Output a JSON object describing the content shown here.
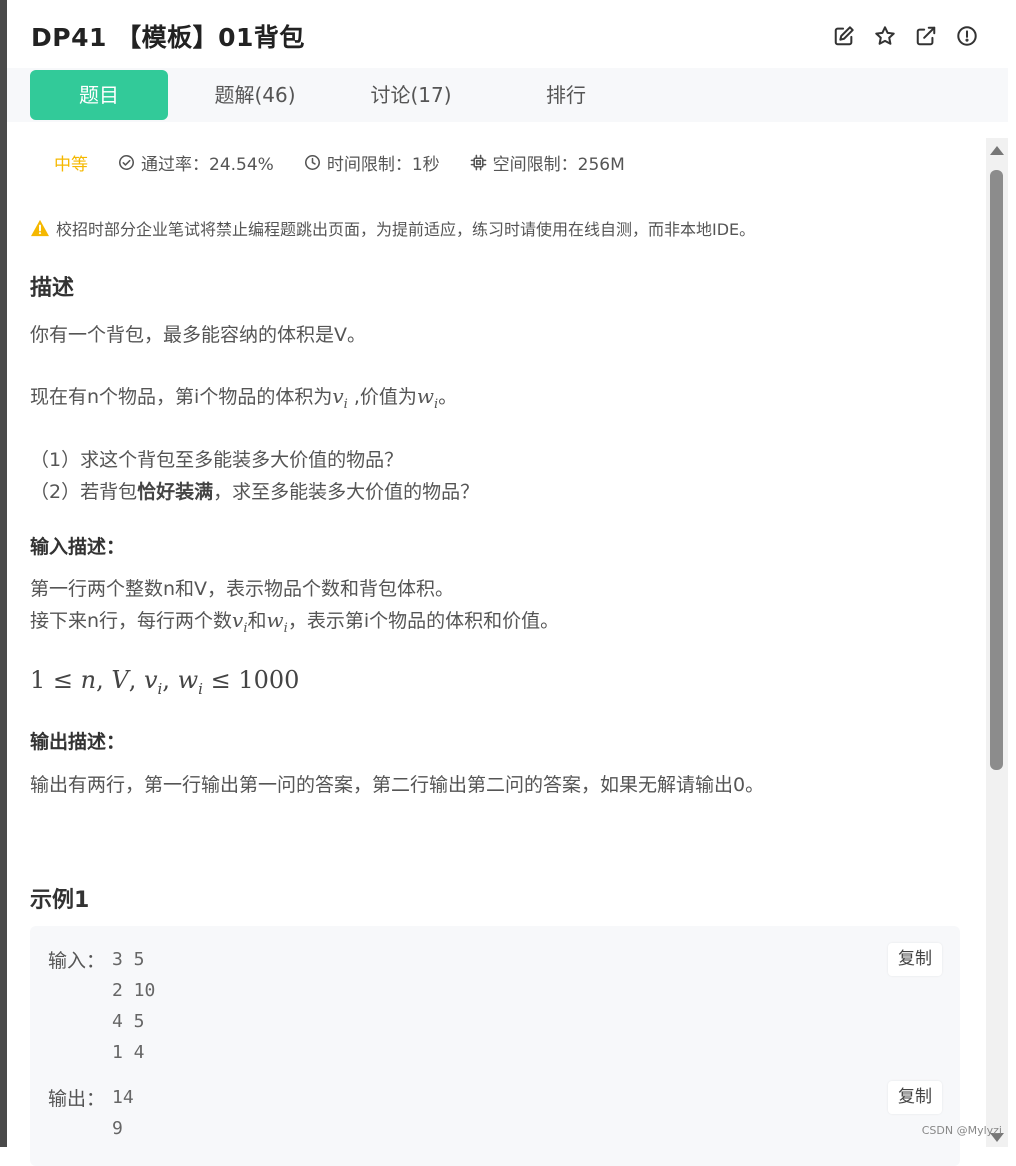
{
  "header": {
    "title": "DP41  【模板】01背包",
    "icons": [
      "edit-icon",
      "star-icon",
      "external-link-icon",
      "report-icon"
    ]
  },
  "tabs": [
    {
      "label": "题目",
      "active": true
    },
    {
      "label": "题解(46)",
      "active": false
    },
    {
      "label": "讨论(17)",
      "active": false
    },
    {
      "label": "排行",
      "active": false
    }
  ],
  "meta": {
    "level": "中等",
    "pass_rate": "通过率：24.54%",
    "time_limit": "时间限制：1秒",
    "space_limit": "空间限制：256M"
  },
  "notice": "校招时部分企业笔试将禁止编程题跳出页面，为提前适应，练习时请使用在线自测，而非本地IDE。",
  "description": {
    "heading": "描述",
    "line1": "你有一个背包，最多能容纳的体积是V。",
    "line2_a": "现在有n个物品，第i个物品的体积为",
    "line2_b": " ,价值为",
    "line2_c": "。",
    "q1": "（1）求这个背包至多能装多大价值的物品？",
    "q2_a": "（2）若背包",
    "q2_bold": "恰好装满",
    "q2_b": "，求至多能装多大价值的物品？"
  },
  "input_desc": {
    "heading": "输入描述：",
    "line1": "第一行两个整数n和V，表示物品个数和背包体积。",
    "line2_a": "接下来n行，每行两个数",
    "line2_b": "和",
    "line2_c": "，表示第i个物品的体积和价值。",
    "constraint": "1 ≤ n, V, v_i, w_i ≤ 1000"
  },
  "output_desc": {
    "heading": "输出描述：",
    "line1": "输出有两行，第一行输出第一问的答案，第二行输出第二问的答案，如果无解请输出0。"
  },
  "example": {
    "heading": "示例1",
    "input_label": "输入：",
    "input_lines": "3 5\n2 10\n4 5\n1 4",
    "output_label": "输出：",
    "output_lines": "14\n9",
    "copy_label": "复制"
  },
  "watermark": "CSDN @Mylyzi",
  "colors": {
    "accent": "#32ca99",
    "level": "#f5b800",
    "warning": "#f5b800"
  }
}
